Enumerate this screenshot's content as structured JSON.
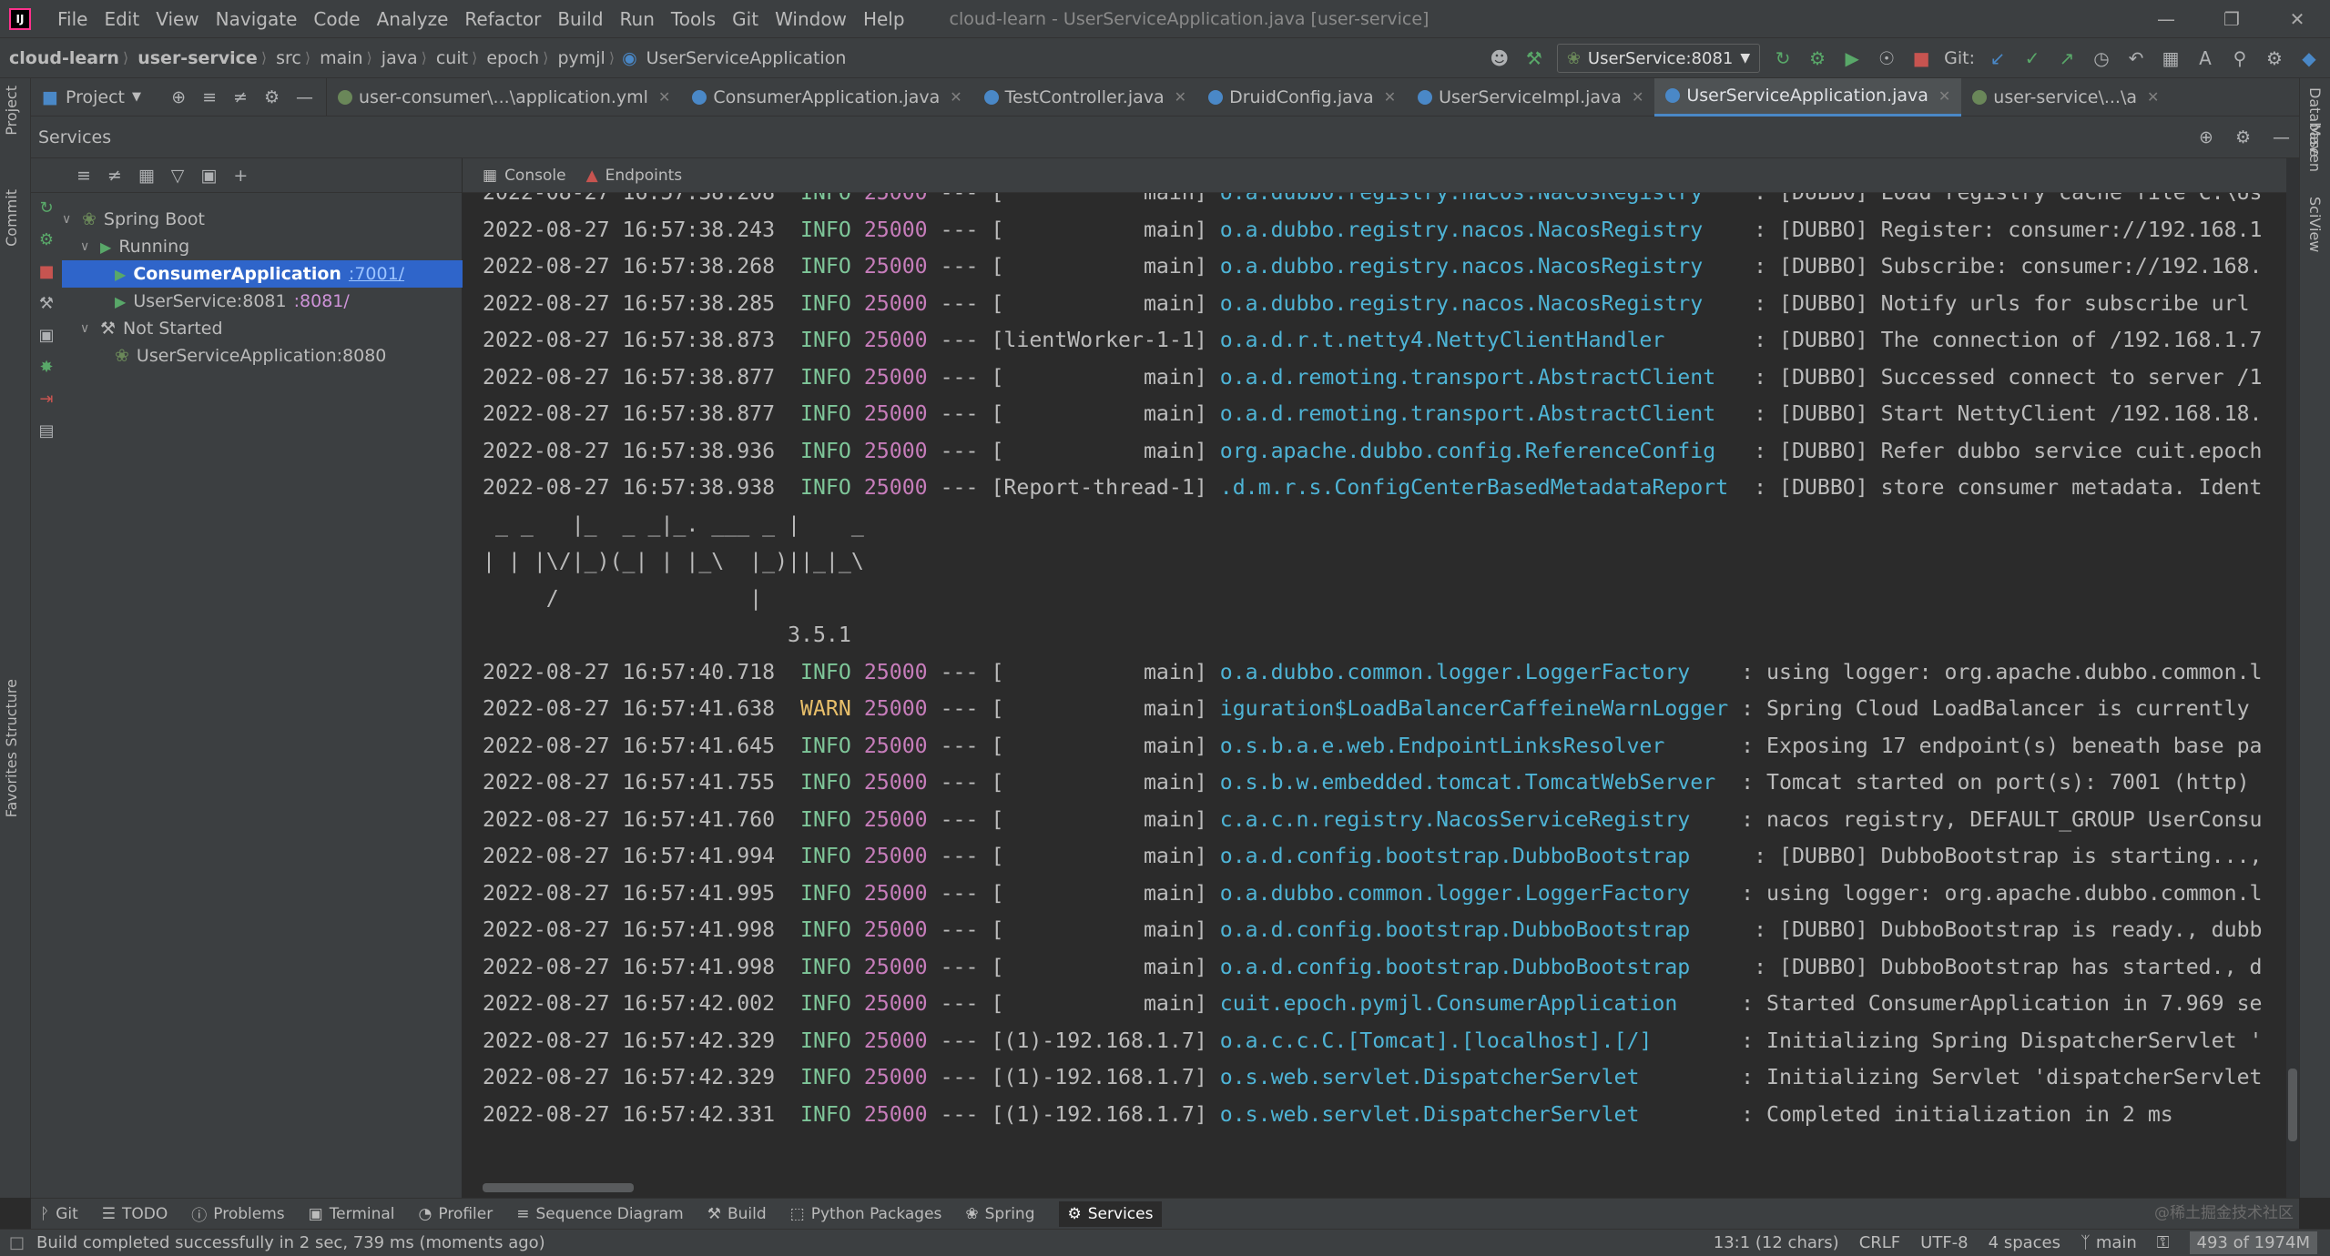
{
  "window": {
    "logo": "IJ",
    "title": "cloud-learn - UserServiceApplication.java [user-service]",
    "menu": [
      "File",
      "Edit",
      "View",
      "Navigate",
      "Code",
      "Analyze",
      "Refactor",
      "Build",
      "Run",
      "Tools",
      "Git",
      "Window",
      "Help"
    ]
  },
  "navbar": {
    "breadcrumbs": [
      "cloud-learn",
      "user-service",
      "src",
      "main",
      "java",
      "cuit",
      "epoch",
      "pymjl",
      "UserServiceApplication"
    ],
    "run_config": "UserService:8081",
    "git_label": "Git:"
  },
  "left_strip": {
    "tabs": [
      "Project",
      "Commit",
      "Structure",
      "Favorites"
    ]
  },
  "right_strip": {
    "tabs": [
      "Database",
      "Maven",
      "SciView"
    ]
  },
  "project_dropdown": {
    "label": "Project"
  },
  "editor_tabs": [
    {
      "label": "user-consumer\\...\\application.yml",
      "icon_color": "#6a8759",
      "active": false
    },
    {
      "label": "ConsumerApplication.java",
      "icon_color": "#4a88c7",
      "active": false
    },
    {
      "label": "TestController.java",
      "icon_color": "#4a88c7",
      "active": false
    },
    {
      "label": "DruidConfig.java",
      "icon_color": "#4a88c7",
      "active": false
    },
    {
      "label": "UserServiceImpl.java",
      "icon_color": "#4a88c7",
      "active": false
    },
    {
      "label": "UserServiceApplication.java",
      "icon_color": "#4a88c7",
      "active": true
    },
    {
      "label": "user-service\\...\\a",
      "icon_color": "#6a8759",
      "active": false
    }
  ],
  "services": {
    "title": "Services",
    "tree": {
      "root": "Spring Boot",
      "running_group": "Running",
      "running": [
        {
          "name": "ConsumerApplication",
          "port": ":7001/",
          "selected": true
        },
        {
          "name": "UserService:8081",
          "port": ":8081/",
          "selected": false
        }
      ],
      "not_started_group": "Not Started",
      "not_started": [
        {
          "name": "UserServiceApplication:8080"
        }
      ]
    }
  },
  "console": {
    "tabs": [
      "Console",
      "Endpoints"
    ],
    "lines_before": [
      {
        "ts": "2022-08-27 16:57:38.208",
        "level": "INFO",
        "pid": "25000",
        "thread": "[           main]",
        "logger": "o.a.dubbo.registry.nacos.NacosRegistry   ",
        "msg": " : [DUBBO] Load registry cache file C:\\Us"
      },
      {
        "ts": "2022-08-27 16:57:38.243",
        "level": "INFO",
        "pid": "25000",
        "thread": "[           main]",
        "logger": "o.a.dubbo.registry.nacos.NacosRegistry   ",
        "msg": " : [DUBBO] Register: consumer://192.168.1"
      },
      {
        "ts": "2022-08-27 16:57:38.268",
        "level": "INFO",
        "pid": "25000",
        "thread": "[           main]",
        "logger": "o.a.dubbo.registry.nacos.NacosRegistry   ",
        "msg": " : [DUBBO] Subscribe: consumer://192.168."
      },
      {
        "ts": "2022-08-27 16:57:38.285",
        "level": "INFO",
        "pid": "25000",
        "thread": "[           main]",
        "logger": "o.a.dubbo.registry.nacos.NacosRegistry   ",
        "msg": " : [DUBBO] Notify urls for subscribe url"
      },
      {
        "ts": "2022-08-27 16:57:38.873",
        "level": "INFO",
        "pid": "25000",
        "thread": "[lientWorker-1-1]",
        "logger": "o.a.d.r.t.netty4.NettyClientHandler      ",
        "msg": " : [DUBBO] The connection of /192.168.1.7"
      },
      {
        "ts": "2022-08-27 16:57:38.877",
        "level": "INFO",
        "pid": "25000",
        "thread": "[           main]",
        "logger": "o.a.d.remoting.transport.AbstractClient  ",
        "msg": " : [DUBBO] Successed connect to server /1"
      },
      {
        "ts": "2022-08-27 16:57:38.877",
        "level": "INFO",
        "pid": "25000",
        "thread": "[           main]",
        "logger": "o.a.d.remoting.transport.AbstractClient  ",
        "msg": " : [DUBBO] Start NettyClient /192.168.18."
      },
      {
        "ts": "2022-08-27 16:57:38.936",
        "level": "INFO",
        "pid": "25000",
        "thread": "[           main]",
        "logger": "org.apache.dubbo.config.ReferenceConfig  ",
        "msg": " : [DUBBO] Refer dubbo service cuit.epoch"
      },
      {
        "ts": "2022-08-27 16:57:38.938",
        "level": "INFO",
        "pid": "25000",
        "thread": "[Report-thread-1]",
        "logger": ".d.m.r.s.ConfigCenterBasedMetadataReport ",
        "msg": " : [DUBBO] store consumer metadata. Ident"
      }
    ],
    "banner": [
      " _ _   |_  _ _|_. ___ _ |    _",
      "| | |\\/|_)(_| | |_\\  |_)||_|_\\",
      "     /               |",
      "                        3.5.1"
    ],
    "lines_after": [
      {
        "ts": "2022-08-27 16:57:40.718",
        "level": "INFO",
        "pid": "25000",
        "thread": "[           main]",
        "logger": "o.a.dubbo.common.logger.LoggerFactory    ",
        "msg": ": using logger: org.apache.dubbo.common.l"
      },
      {
        "ts": "2022-08-27 16:57:41.638",
        "level": "WARN",
        "pid": "25000",
        "thread": "[           main]",
        "logger": "iguration$LoadBalancerCaffeineWarnLogger ",
        "msg": ": Spring Cloud LoadBalancer is currently"
      },
      {
        "ts": "2022-08-27 16:57:41.645",
        "level": "INFO",
        "pid": "25000",
        "thread": "[           main]",
        "logger": "o.s.b.a.e.web.EndpointLinksResolver      ",
        "msg": ": Exposing 17 endpoint(s) beneath base pa"
      },
      {
        "ts": "2022-08-27 16:57:41.755",
        "level": "INFO",
        "pid": "25000",
        "thread": "[           main]",
        "logger": "o.s.b.w.embedded.tomcat.TomcatWebServer  ",
        "msg": ": Tomcat started on port(s): 7001 (http)"
      },
      {
        "ts": "2022-08-27 16:57:41.760",
        "level": "INFO",
        "pid": "25000",
        "thread": "[           main]",
        "logger": "c.a.c.n.registry.NacosServiceRegistry    ",
        "msg": ": nacos registry, DEFAULT_GROUP UserConsu"
      },
      {
        "ts": "2022-08-27 16:57:41.994",
        "level": "INFO",
        "pid": "25000",
        "thread": "[           main]",
        "logger": "o.a.d.config.bootstrap.DubboBootstrap    ",
        "msg": " : [DUBBO] DubboBootstrap is starting...,"
      },
      {
        "ts": "2022-08-27 16:57:41.995",
        "level": "INFO",
        "pid": "25000",
        "thread": "[           main]",
        "logger": "o.a.dubbo.common.logger.LoggerFactory    ",
        "msg": ": using logger: org.apache.dubbo.common.l"
      },
      {
        "ts": "2022-08-27 16:57:41.998",
        "level": "INFO",
        "pid": "25000",
        "thread": "[           main]",
        "logger": "o.a.d.config.bootstrap.DubboBootstrap    ",
        "msg": " : [DUBBO] DubboBootstrap is ready., dubb"
      },
      {
        "ts": "2022-08-27 16:57:41.998",
        "level": "INFO",
        "pid": "25000",
        "thread": "[           main]",
        "logger": "o.a.d.config.bootstrap.DubboBootstrap    ",
        "msg": " : [DUBBO] DubboBootstrap has started., d"
      },
      {
        "ts": "2022-08-27 16:57:42.002",
        "level": "INFO",
        "pid": "25000",
        "thread": "[           main]",
        "logger": "cuit.epoch.pymjl.ConsumerApplication     ",
        "msg": ": Started ConsumerApplication in 7.969 se"
      },
      {
        "ts": "2022-08-27 16:57:42.329",
        "level": "INFO",
        "pid": "25000",
        "thread": "[(1)-192.168.1.7]",
        "logger": "o.a.c.c.C.[Tomcat].[localhost].[/]       ",
        "msg": ": Initializing Spring DispatcherServlet '"
      },
      {
        "ts": "2022-08-27 16:57:42.329",
        "level": "INFO",
        "pid": "25000",
        "thread": "[(1)-192.168.1.7]",
        "logger": "o.s.web.servlet.DispatcherServlet        ",
        "msg": ": Initializing Servlet 'dispatcherServlet"
      },
      {
        "ts": "2022-08-27 16:57:42.331",
        "level": "INFO",
        "pid": "25000",
        "thread": "[(1)-192.168.1.7]",
        "logger": "o.s.web.servlet.DispatcherServlet        ",
        "msg": ": Completed initialization in 2 ms"
      }
    ]
  },
  "tool_tabs": [
    {
      "label": "Git",
      "icon": "git-branch-icon"
    },
    {
      "label": "TODO",
      "icon": "list-icon"
    },
    {
      "label": "Problems",
      "icon": "info-icon"
    },
    {
      "label": "Terminal",
      "icon": "terminal-icon"
    },
    {
      "label": "Profiler",
      "icon": "profiler-icon"
    },
    {
      "label": "Sequence Diagram",
      "icon": "sequence-icon"
    },
    {
      "label": "Build",
      "icon": "hammer-icon"
    },
    {
      "label": "Python Packages",
      "icon": "layers-icon"
    },
    {
      "label": "Spring",
      "icon": "leaf-icon"
    },
    {
      "label": "Services",
      "icon": "services-icon",
      "active": true
    }
  ],
  "statusbar": {
    "message": "Build completed successfully in 2 sec, 739 ms (moments ago)",
    "position": "13:1 (12 chars)",
    "line_sep": "CRLF",
    "encoding": "UTF-8",
    "indent": "4 spaces",
    "branch": "main",
    "memory": "493 of 1974M"
  },
  "watermark": "@稀土掘金技术社区",
  "colors": {
    "info": "#7ec699",
    "warn": "#e8bf6a",
    "pid": "#c77dbb",
    "logger": "#4eb4d6",
    "selection": "#2f65ca"
  }
}
